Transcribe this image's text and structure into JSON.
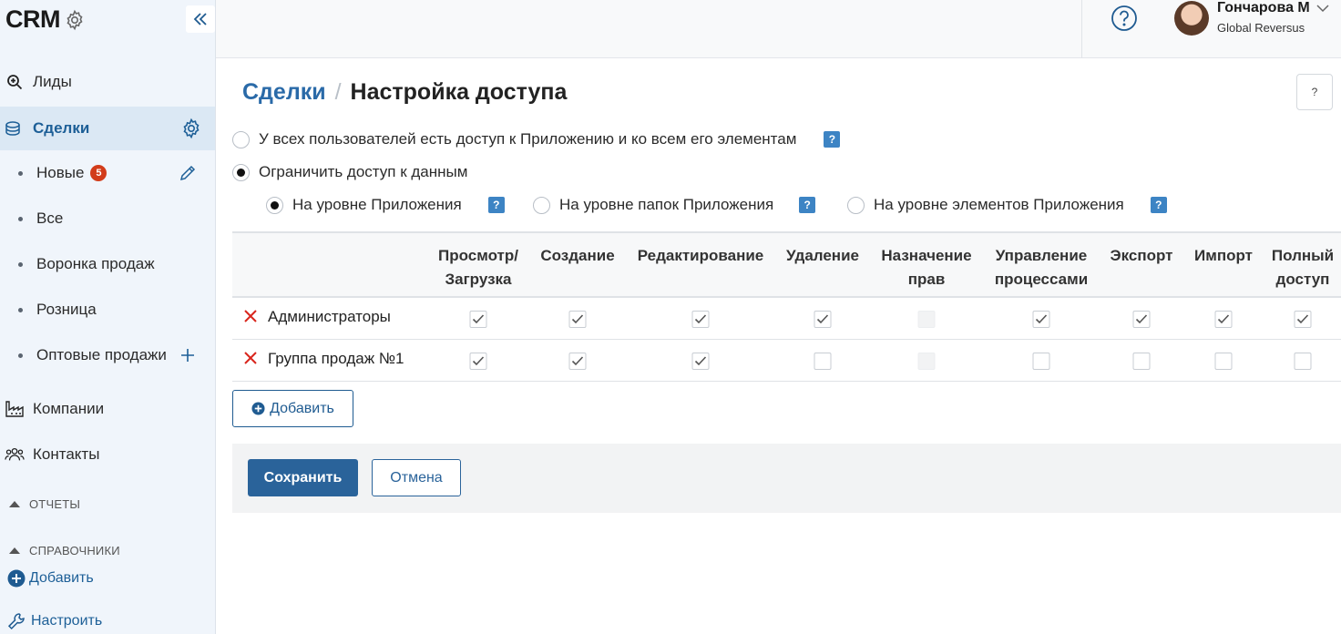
{
  "app": {
    "title": "CRM"
  },
  "sidebar": {
    "items": [
      {
        "label": "Лиды",
        "icon": "search-zoom-icon"
      },
      {
        "label": "Сделки",
        "icon": "coins-stack-icon",
        "active": true
      },
      {
        "label": "Компании",
        "icon": "factory-icon"
      },
      {
        "label": "Контакты",
        "icon": "people-icon"
      }
    ],
    "sub_items": [
      {
        "label": "Новые",
        "badge": "5"
      },
      {
        "label": "Все"
      },
      {
        "label": "Воронка продаж"
      },
      {
        "label": "Розница"
      },
      {
        "label": "Оптовые продажи"
      }
    ],
    "sections": {
      "reports": "ОТЧЕТЫ",
      "references": "СПРАВОЧНИКИ"
    },
    "add_label": "Добавить",
    "configure_label": "Настроить"
  },
  "header": {
    "user_name": "Гончарова М",
    "user_org": "Global Reversus"
  },
  "page": {
    "breadcrumb_parent": "Сделки",
    "breadcrumb_sep": "/",
    "title": "Настройка доступа",
    "help_label": "?"
  },
  "access": {
    "all_users": "У всех пользователей есть доступ к Приложению и ко всем его элементам",
    "restrict": "Ограничить доступ к данным",
    "levels": [
      {
        "label": "На уровне Приложения",
        "selected": true
      },
      {
        "label": "На уровне папок Приложения",
        "selected": false
      },
      {
        "label": "На уровне элементов Приложения",
        "selected": false
      }
    ],
    "q_label": "?"
  },
  "table": {
    "columns": [
      [
        "Просмотр/",
        "Загрузка"
      ],
      [
        "Создание",
        ""
      ],
      [
        "Редактирование",
        ""
      ],
      [
        "Удаление",
        ""
      ],
      [
        "Назначение",
        "прав"
      ],
      [
        "Управление",
        "процессами"
      ],
      [
        "Экспорт",
        ""
      ],
      [
        "Импорт",
        ""
      ],
      [
        "Полный",
        "доступ"
      ]
    ],
    "rows": [
      {
        "name": "Администраторы",
        "checks": [
          true,
          true,
          true,
          true,
          null,
          true,
          true,
          true,
          true
        ]
      },
      {
        "name": "Группа продаж №1",
        "checks": [
          true,
          true,
          true,
          false,
          null,
          false,
          false,
          false,
          false
        ]
      }
    ]
  },
  "buttons": {
    "add": "Добавить",
    "save": "Сохранить",
    "cancel": "Отмена"
  },
  "colors": {
    "accent": "#2a639a",
    "link": "#2a6aa8",
    "badge": "#d23c1a",
    "remove": "#d9251c"
  }
}
